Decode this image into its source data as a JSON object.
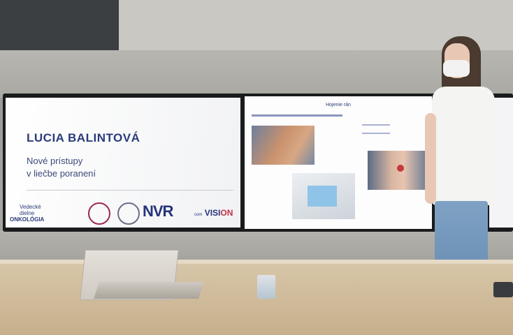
{
  "slide_left": {
    "name": "LUCIA BALINTOVÁ",
    "subtitle_line1": "Nové prístupy",
    "subtitle_line2": "v liečbe poranení",
    "org_line1": "Vedecké",
    "org_line2": "dielne",
    "org_line3": "ONKOLÓGIA",
    "logo_text": "NVR",
    "vision_small": "com",
    "vision_main": "VISI",
    "vision_accent": "ON"
  },
  "slide_center": {
    "title": "Hojenie rán"
  },
  "colors": {
    "navy": "#27337a",
    "accent_red": "#c03040",
    "bezel": "#1a1b1d"
  }
}
